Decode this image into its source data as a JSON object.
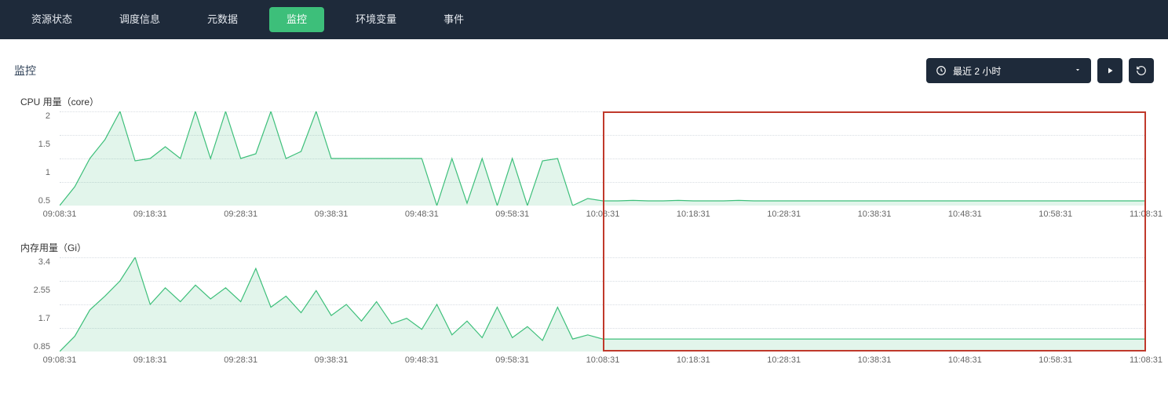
{
  "tabs": [
    {
      "label": "资源状态",
      "active": false
    },
    {
      "label": "调度信息",
      "active": false
    },
    {
      "label": "元数据",
      "active": false
    },
    {
      "label": "监控",
      "active": true
    },
    {
      "label": "环境变量",
      "active": false
    },
    {
      "label": "事件",
      "active": false
    }
  ],
  "section_title": "监控",
  "time_range": {
    "label": "最近 2 小时",
    "icon": "clock-icon"
  },
  "colors": {
    "line": "#3dbf7a",
    "fill": "rgba(61,191,122,0.15)",
    "highlight": "#c0392b"
  },
  "x_categories": [
    "09:08:31",
    "09:18:31",
    "09:28:31",
    "09:38:31",
    "09:48:31",
    "09:58:31",
    "10:08:31",
    "10:18:31",
    "10:28:31",
    "10:38:31",
    "10:48:31",
    "10:58:31",
    "11:08:31"
  ],
  "chart_data": [
    {
      "id": "cpu",
      "type": "area",
      "title": "CPU 用量（core）",
      "xlabel": "",
      "ylabel": "",
      "ylim": [
        0,
        2
      ],
      "yticks": [
        0.5,
        1,
        1.5,
        2
      ],
      "categories": [
        "09:08:31",
        "09:18:31",
        "09:28:31",
        "09:38:31",
        "09:48:31",
        "09:58:31",
        "10:08:31",
        "10:18:31",
        "10:28:31",
        "10:38:31",
        "10:48:31",
        "10:58:31",
        "11:08:31"
      ],
      "values": [
        0,
        0.4,
        1.0,
        1.4,
        2.0,
        0.95,
        1.0,
        1.25,
        1.0,
        2.0,
        1.0,
        2.0,
        1.0,
        1.1,
        2.0,
        1.0,
        1.15,
        2.0,
        1.0,
        1.0,
        1.0,
        1.0,
        1.0,
        1.0,
        1.0,
        0.0,
        1.0,
        0.05,
        1.0,
        0.0,
        1.0,
        0.0,
        0.95,
        1.0,
        0.0,
        0.15,
        0.1,
        0.1,
        0.11,
        0.1,
        0.1,
        0.11,
        0.1,
        0.1,
        0.1,
        0.11,
        0.1,
        0.1,
        0.1,
        0.1,
        0.1,
        0.1,
        0.1,
        0.1,
        0.1,
        0.1,
        0.1,
        0.1,
        0.1,
        0.1,
        0.1,
        0.1,
        0.1,
        0.1,
        0.1,
        0.1,
        0.1,
        0.1,
        0.1,
        0.1,
        0.1,
        0.1,
        0.1
      ]
    },
    {
      "id": "memory",
      "type": "area",
      "title": "内存用量（Gi）",
      "xlabel": "",
      "ylabel": "",
      "ylim": [
        0,
        3.4
      ],
      "yticks": [
        0.85,
        1.7,
        2.55,
        3.4
      ],
      "categories": [
        "09:08:31",
        "09:18:31",
        "09:28:31",
        "09:38:31",
        "09:48:31",
        "09:58:31",
        "10:08:31",
        "10:18:31",
        "10:28:31",
        "10:38:31",
        "10:48:31",
        "10:58:31",
        "11:08:31"
      ],
      "values": [
        0,
        0.55,
        1.5,
        2.0,
        2.55,
        3.4,
        1.7,
        2.3,
        1.8,
        2.4,
        1.9,
        2.3,
        1.8,
        3.0,
        1.6,
        2.0,
        1.4,
        2.2,
        1.3,
        1.7,
        1.1,
        1.8,
        1.0,
        1.2,
        0.8,
        1.7,
        0.6,
        1.1,
        0.5,
        1.6,
        0.5,
        0.9,
        0.4,
        1.6,
        0.45,
        0.6,
        0.45,
        0.45,
        0.45,
        0.45,
        0.45,
        0.45,
        0.45,
        0.45,
        0.45,
        0.45,
        0.45,
        0.45,
        0.45,
        0.45,
        0.45,
        0.45,
        0.45,
        0.45,
        0.45,
        0.45,
        0.45,
        0.45,
        0.45,
        0.45,
        0.45,
        0.45,
        0.45,
        0.45,
        0.45,
        0.45,
        0.45,
        0.45,
        0.45,
        0.45,
        0.45,
        0.45,
        0.45
      ]
    }
  ],
  "highlight": {
    "x_from_idx": 6,
    "x_to_idx": 12
  }
}
